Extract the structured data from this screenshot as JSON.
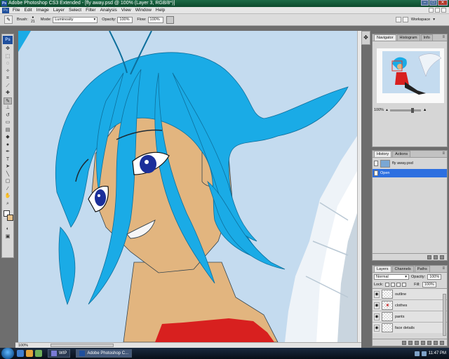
{
  "window": {
    "title": "Adobe Photoshop CS3 Extended - [fly away.psd @ 100% (Layer 3, RGB/8*)]",
    "app_icon": "Ps"
  },
  "menu": [
    "File",
    "Edit",
    "Image",
    "Layer",
    "Select",
    "Filter",
    "Analysis",
    "View",
    "Window",
    "Help"
  ],
  "options": {
    "brush_label": "Brush:",
    "brush_size": "21",
    "mode_label": "Mode:",
    "mode_value": "Luminosity",
    "opacity_label": "Opacity:",
    "opacity_value": "100%",
    "flow_label": "Flow:",
    "flow_value": "100%",
    "workspace_label": "Workspace"
  },
  "toolbox": {
    "badge": "Ps",
    "foreground_color": "#ffffff",
    "background_color": "#e9c28a"
  },
  "navigator": {
    "tabs": [
      "Navigator",
      "Histogram",
      "Info"
    ],
    "zoom": "100%"
  },
  "history": {
    "tabs": [
      "History",
      "Actions"
    ],
    "items": [
      {
        "label": "fly away.psd",
        "type": "snapshot"
      },
      {
        "label": "Open",
        "type": "state",
        "selected": true
      }
    ]
  },
  "layers": {
    "tabs": [
      "Layers",
      "Channels",
      "Paths"
    ],
    "blend_mode": "Normal",
    "opacity_label": "Opacity:",
    "opacity_value": "100%",
    "lock_label": "Lock:",
    "fill_label": "Fill:",
    "fill_value": "100%",
    "items": [
      {
        "name": "outline"
      },
      {
        "name": "clothes"
      },
      {
        "name": "pants"
      },
      {
        "name": "face details"
      }
    ]
  },
  "status": {
    "zoom": "100%"
  },
  "taskbar": {
    "tasks": [
      {
        "label": "WIP",
        "active": false
      },
      {
        "label": "Adobe Photoshop C...",
        "active": true
      }
    ],
    "time": "11:47 PM"
  },
  "colors": {
    "hair": "#1aabe6",
    "skin": "#e2b57f",
    "background": "#c4dbef",
    "shirt": "#d8201f",
    "eyes": "#1b2f9a"
  }
}
